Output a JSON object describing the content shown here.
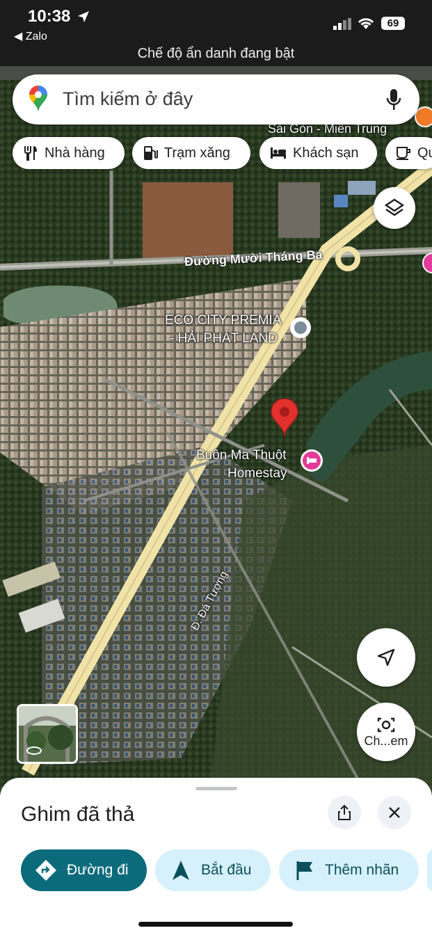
{
  "status": {
    "time": "10:38",
    "back_app": "◀ Zalo",
    "battery": "69",
    "incognito_text": "Chế độ ẩn danh đang bật"
  },
  "search": {
    "placeholder": "Tìm kiếm ở đây"
  },
  "chips": [
    {
      "label": "Nhà hàng",
      "icon": "restaurant-icon"
    },
    {
      "label": "Trạm xăng",
      "icon": "gas-station-icon"
    },
    {
      "label": "Khách sạn",
      "icon": "hotel-icon"
    },
    {
      "label": "Qu",
      "icon": "coffee-icon"
    }
  ],
  "map": {
    "labels": {
      "sai_gon": "Sài Gòn - Miền Trung",
      "road_main": "Đường Mười Tháng Ba",
      "eco_city_1": "ECO CITY PREMIA",
      "eco_city_2": "- HẢI PHÁT LAND",
      "homestay_1": "Buôn Ma Thuột",
      "homestay_2": "Homestay",
      "da_tuong": "Đ. Đá Tượng"
    },
    "camera_button_label": "Ch...em"
  },
  "sheet": {
    "title": "Ghim đã thả",
    "actions": [
      {
        "label": "Đường đi",
        "icon": "directions-icon"
      },
      {
        "label": "Bắt đầu",
        "icon": "navigation-arrow-icon"
      },
      {
        "label": "Thêm nhãn",
        "icon": "flag-icon"
      }
    ]
  },
  "colors": {
    "primary_button": "#0b6b7b",
    "secondary_button": "#d6f1fb",
    "pin_red": "#e0312c",
    "road_yellow": "#f1e3a8"
  }
}
